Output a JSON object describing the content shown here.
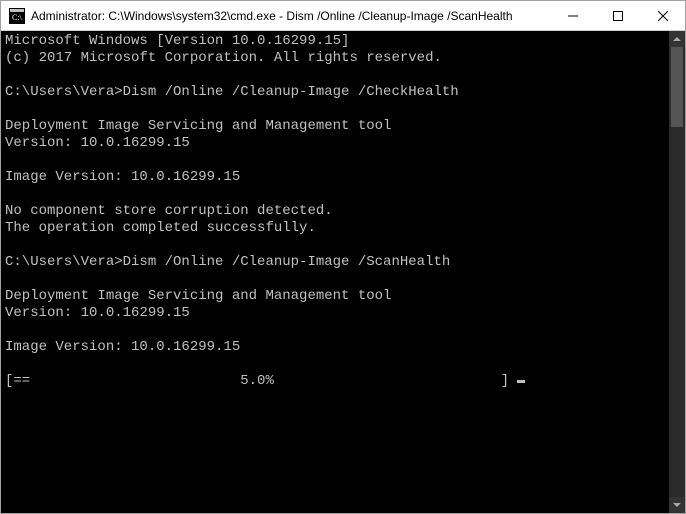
{
  "window": {
    "title": "Administrator: C:\\Windows\\system32\\cmd.exe - Dism  /Online /Cleanup-Image /ScanHealth"
  },
  "terminal": {
    "lines": [
      "Microsoft Windows [Version 10.0.16299.15]",
      "(c) 2017 Microsoft Corporation. All rights reserved.",
      "",
      "C:\\Users\\Vera>Dism /Online /Cleanup-Image /CheckHealth",
      "",
      "Deployment Image Servicing and Management tool",
      "Version: 10.0.16299.15",
      "",
      "Image Version: 10.0.16299.15",
      "",
      "No component store corruption detected.",
      "The operation completed successfully.",
      "",
      "C:\\Users\\Vera>Dism /Online /Cleanup-Image /ScanHealth",
      "",
      "Deployment Image Servicing and Management tool",
      "Version: 10.0.16299.15",
      "",
      "Image Version: 10.0.16299.15",
      "",
      "[==                         5.0%                           ] "
    ],
    "progress_percent": "5.0%"
  }
}
